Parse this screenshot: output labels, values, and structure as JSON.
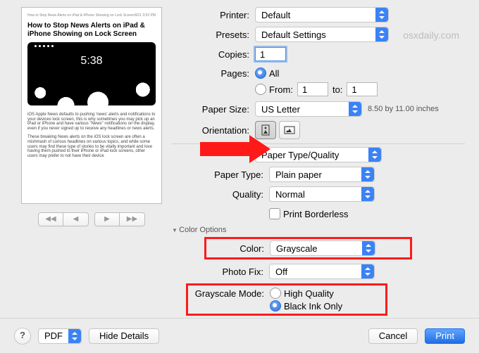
{
  "labels": {
    "printer": "Printer:",
    "presets": "Presets:",
    "copies": "Copies:",
    "pages": "Pages:",
    "to": "to:",
    "paper_size": "Paper Size:",
    "orientation": "Orientation:",
    "paper_type": "Paper Type:",
    "quality": "Quality:",
    "print_borderless": "Print Borderless",
    "color_options": "Color Options",
    "color": "Color:",
    "photo_fix": "Photo Fix:",
    "grayscale_mode": "Grayscale Mode:",
    "all": "All",
    "from": "From:",
    "high_quality": "High Quality",
    "black_ink_only": "Black Ink Only"
  },
  "values": {
    "printer": "Default",
    "presets": "Default Settings",
    "copies": "1",
    "pages_mode": "all",
    "from": "1",
    "to": "1",
    "paper_size": "US Letter",
    "paper_dims": "8.50 by 11.00 inches",
    "section": "Paper Type/Quality",
    "paper_type": "Plain paper",
    "quality": "Normal",
    "borderless": false,
    "color": "Grayscale",
    "photo_fix": "Off",
    "grayscale_mode": "black_ink_only"
  },
  "preview": {
    "title": "How to Stop News Alerts on iPad & iPhone Showing on Lock Screen",
    "p1": "iOS Apple News defaults to pushing 'news' alerts and notifications to your devices lock screen, this is why sometimes you may pick up an iPad or iPhone and have various \"News\" notifications on the display, even if you never signed up to receive any headlines or news alerts.",
    "p2": "These breaking News alerts on the iOS lock screen are often a mishmash of curious headlines on various topics, and while some users may find these type of stories to be vitally important and love having them pushed to their iPhone or iPad lock screens, other users may prefer to not have their device"
  },
  "footer": {
    "pdf": "PDF",
    "hide_details": "Hide Details",
    "cancel": "Cancel",
    "print": "Print"
  },
  "watermark": "osxdaily.com"
}
